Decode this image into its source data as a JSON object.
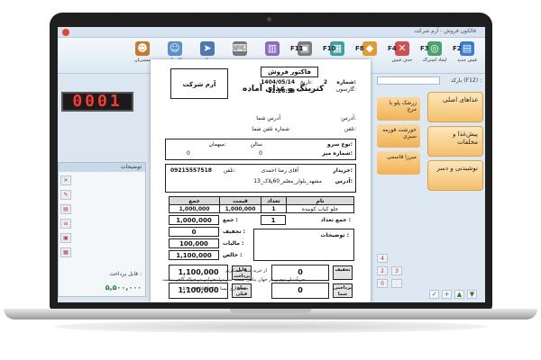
{
  "window": {
    "title": "فالکون فروش - آرم شرکت"
  },
  "toolbar": {
    "items": [
      {
        "fkey": "F2",
        "label": "فیش جدید",
        "color": "#3a7bd5",
        "icon": "new-receipt-icon"
      },
      {
        "fkey": "F3",
        "label": "ایجاد اشتراک",
        "color": "#4aa36b",
        "icon": "subscription-icon"
      },
      {
        "fkey": "F4",
        "label": "حذف فیش",
        "color": "#d05050",
        "icon": "delete-receipt-icon"
      },
      {
        "fkey": "F8",
        "label": "",
        "color": "#e09a2f",
        "icon": "tag-icon"
      },
      {
        "fkey": "F10",
        "label": "",
        "color": "#3aa0a0",
        "icon": "calculator-icon"
      },
      {
        "fkey": "F11",
        "label": "",
        "color": "#7a7a7a",
        "icon": "print-icon"
      },
      {
        "fkey": "",
        "label": "",
        "color": "#8a6bbf",
        "icon": "printer-icon"
      },
      {
        "fkey": "",
        "label": "",
        "color": "#777777",
        "icon": "keyboard-icon"
      },
      {
        "fkey": "",
        "label": "بیک",
        "color": "#4d78b0",
        "icon": "courier-icon"
      },
      {
        "fkey": "",
        "label": "کاربران",
        "color": "#5b8fcf",
        "icon": "users-icon"
      },
      {
        "fkey": "",
        "label": "مشتریان",
        "color": "#c77a2c",
        "icon": "customers-icon"
      }
    ]
  },
  "left": {
    "display": "0001",
    "grid_header": "توضیحات",
    "total_label": "قابل پرداخت :",
    "total_value": "۵,۵۰۰,۰۰۰"
  },
  "right": {
    "search_label": "بارکد (F12) :",
    "categories": [
      "غذاهای اصلی",
      "پیش‌غذا و مخلفات",
      "نوشیدنی و دسر"
    ],
    "foods": [
      "زرشک پلو با مرغ",
      "خورشت قورمه سبزی",
      "میرزا قاسمی"
    ]
  },
  "receipt": {
    "title": "فاکتور فروش",
    "brand": "آرم شرکت",
    "business_name": "کترینگ و غذای آماده",
    "number_label": "شماره:",
    "number": "2",
    "date_label": "تاریخ:",
    "date": "1404/05/14",
    "time_label": "ساعت:",
    "time": "12:26:59",
    "server_label": "گارسون:",
    "address_label": "آدرس:",
    "address": "آدرس شما",
    "phone_label": "تلفن:",
    "phone": "شماره تلفن شما",
    "service_type_label": "نوع سرو:",
    "service_type": "سالن",
    "table_label": "شماره میز:",
    "table": "0",
    "guest_label": "میهمان:",
    "guest": "0",
    "customer_label": "خریدار:",
    "customer": "آقای رضا احمدی",
    "customer_phone_label": "تلفن:",
    "customer_phone": "09215557518",
    "customer_address_label": "آدرس:",
    "customer_address": "مشهد_بلوار_معلم_60پلاک_13",
    "columns": [
      "جمع",
      "قیمت",
      "تعداد",
      "نام"
    ],
    "rows": [
      {
        "name": "جلو کباب کوبیده",
        "qty": "1",
        "price": "1,000,000",
        "total": "1,000,000"
      }
    ],
    "total_qty_label": "جمع تعداد :",
    "total_qty": "1",
    "sum_label": "جمع :",
    "sum": "1,000,000",
    "discount_label": "تخفیف :",
    "discount": "0",
    "tax_label": "مالیات :",
    "tax": "100,000",
    "net_label": "خالص :",
    "net": "1,100,000",
    "notes_label": "توضیحات :",
    "pay_amount": "1,100,000",
    "pay_amount_label": "قابل پرداخت",
    "remain": "0",
    "remain_label": "تخفیف",
    "paid": "1,100,000",
    "paid_label": "مبلغ قبلی",
    "balance": "0",
    "balance_label": "پرداختی شما",
    "thanks": "از خرید شما متشکریم",
    "footer": "جز آستان توم ن در جهان پناهی نیست    سر مرا بجز این در حواله گاهی نیست",
    "footer_phone": "حسابداری نیمنا ۰۹۱۵۵۵۵۱۳۸۱ - ۰۵۱"
  }
}
